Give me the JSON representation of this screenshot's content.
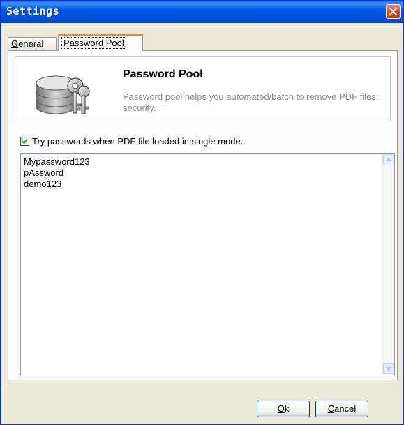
{
  "window": {
    "title": "Settings"
  },
  "tabs": {
    "general_prefix": "",
    "general_mnemonic": "G",
    "general_rest": "eneral",
    "pool_mnemonic": "P",
    "pool_rest": "assword Pool"
  },
  "header": {
    "icon": "keys-database-icon",
    "title": "Password Pool",
    "description": "Password pool helps you automated/batch to remove PDF files security."
  },
  "option": {
    "checked": true,
    "label": "Try passwords when PDF file loaded in single mode."
  },
  "passwords": {
    "lines": [
      "Mypassword123",
      "pAssword",
      "demo123"
    ]
  },
  "buttons": {
    "ok_mnemonic": "O",
    "ok_rest": "k",
    "cancel_mnemonic": "C",
    "cancel_rest": "ancel"
  },
  "colors": {
    "title_bar": "#0058e6",
    "close_button": "#d8502d",
    "active_tab_accent": "#e68b2c",
    "window_face": "#ece9d8"
  }
}
